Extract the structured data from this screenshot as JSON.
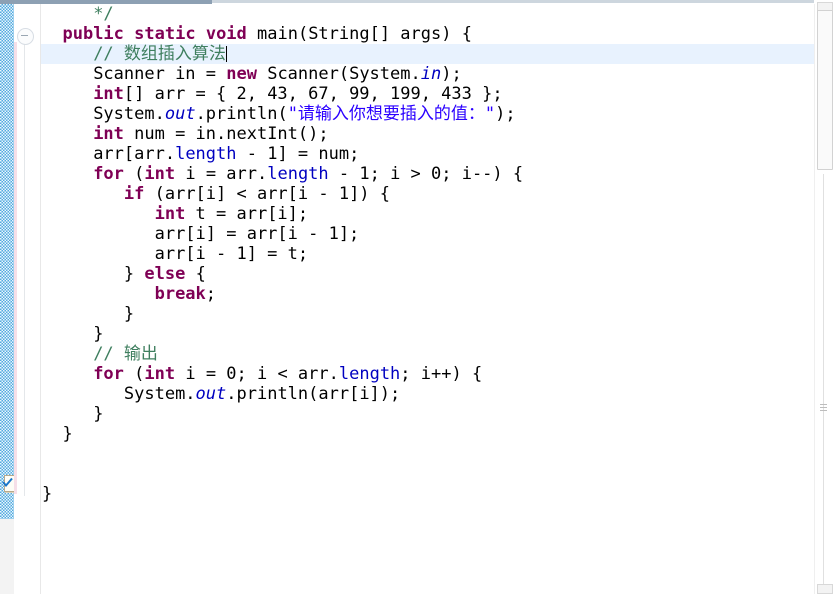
{
  "app": {
    "name": "eclipse-java-editor",
    "language": "java"
  },
  "colors": {
    "keyword": "#7f0055",
    "string": "#2a00ff",
    "comment": "#3f7f5f",
    "field": "#0000c0",
    "plain": "#000000",
    "current_line_highlight": "#e8f2fe",
    "marker_ruler": "#49a6dc",
    "background": "#ffffff"
  },
  "gutter": {
    "fold_marker_icon": "collapse-minus-icon",
    "marker_icon": "quickfix-checkmark-icon"
  },
  "scrollbar": {
    "orientation": "vertical",
    "thumb_top_pct": 1,
    "thumb_height_pct": 27,
    "up_arrow_icon": "scroll-up-arrow-icon",
    "down_arrow_icon": "scroll-down-arrow-icon"
  },
  "editor": {
    "current_line_index": 2,
    "caret_line_index": 2,
    "lines": [
      {
        "indent": 5,
        "tokens": [
          {
            "t": "cmt",
            "s": "*/"
          }
        ]
      },
      {
        "indent": 2,
        "tokens": [
          {
            "t": "kw",
            "s": "public"
          },
          {
            "t": "plain",
            "s": " "
          },
          {
            "t": "kw",
            "s": "static"
          },
          {
            "t": "plain",
            "s": " "
          },
          {
            "t": "kw",
            "s": "void"
          },
          {
            "t": "plain",
            "s": " main(String[] args) {"
          }
        ]
      },
      {
        "indent": 5,
        "current": true,
        "caret": true,
        "tokens": [
          {
            "t": "cmt",
            "s": "// 数组插入算法"
          }
        ]
      },
      {
        "indent": 5,
        "tokens": [
          {
            "t": "plain",
            "s": "Scanner in = "
          },
          {
            "t": "kw",
            "s": "new"
          },
          {
            "t": "plain",
            "s": " Scanner(System."
          },
          {
            "t": "statfld",
            "s": "in"
          },
          {
            "t": "plain",
            "s": ");"
          }
        ]
      },
      {
        "indent": 5,
        "tokens": [
          {
            "t": "kw",
            "s": "int"
          },
          {
            "t": "plain",
            "s": "[] arr = { 2, 43, 67, 99, 199, 433 };"
          }
        ]
      },
      {
        "indent": 5,
        "tokens": [
          {
            "t": "plain",
            "s": "System."
          },
          {
            "t": "statfld",
            "s": "out"
          },
          {
            "t": "plain",
            "s": ".println("
          },
          {
            "t": "str",
            "s": "\"请输入你想要插入的值：\""
          },
          {
            "t": "plain",
            "s": ");"
          }
        ]
      },
      {
        "indent": 5,
        "tokens": [
          {
            "t": "kw",
            "s": "int"
          },
          {
            "t": "plain",
            "s": " num = in.nextInt();"
          }
        ]
      },
      {
        "indent": 5,
        "tokens": [
          {
            "t": "plain",
            "s": "arr[arr."
          },
          {
            "t": "field",
            "s": "length"
          },
          {
            "t": "plain",
            "s": " - 1] = num;"
          }
        ]
      },
      {
        "indent": 5,
        "tokens": [
          {
            "t": "kw",
            "s": "for"
          },
          {
            "t": "plain",
            "s": " ("
          },
          {
            "t": "kw",
            "s": "int"
          },
          {
            "t": "plain",
            "s": " i = arr."
          },
          {
            "t": "field",
            "s": "length"
          },
          {
            "t": "plain",
            "s": " - 1; i > 0; i--) {"
          }
        ]
      },
      {
        "indent": 8,
        "tokens": [
          {
            "t": "kw",
            "s": "if"
          },
          {
            "t": "plain",
            "s": " (arr[i] < arr[i - 1]) {"
          }
        ]
      },
      {
        "indent": 11,
        "tokens": [
          {
            "t": "kw",
            "s": "int"
          },
          {
            "t": "plain",
            "s": " t = arr[i];"
          }
        ]
      },
      {
        "indent": 11,
        "tokens": [
          {
            "t": "plain",
            "s": "arr[i] = arr[i - 1];"
          }
        ]
      },
      {
        "indent": 11,
        "tokens": [
          {
            "t": "plain",
            "s": "arr[i - 1] = t;"
          }
        ]
      },
      {
        "indent": 8,
        "tokens": [
          {
            "t": "plain",
            "s": "} "
          },
          {
            "t": "kw",
            "s": "else"
          },
          {
            "t": "plain",
            "s": " {"
          }
        ]
      },
      {
        "indent": 11,
        "tokens": [
          {
            "t": "kw",
            "s": "break"
          },
          {
            "t": "plain",
            "s": ";"
          }
        ]
      },
      {
        "indent": 8,
        "tokens": [
          {
            "t": "plain",
            "s": "}"
          }
        ]
      },
      {
        "indent": 5,
        "tokens": [
          {
            "t": "plain",
            "s": "}"
          }
        ]
      },
      {
        "indent": 5,
        "tokens": [
          {
            "t": "cmt",
            "s": "// 输出"
          }
        ]
      },
      {
        "indent": 5,
        "tokens": [
          {
            "t": "kw",
            "s": "for"
          },
          {
            "t": "plain",
            "s": " ("
          },
          {
            "t": "kw",
            "s": "int"
          },
          {
            "t": "plain",
            "s": " i = 0; i < arr."
          },
          {
            "t": "field",
            "s": "length"
          },
          {
            "t": "plain",
            "s": "; i++) {"
          }
        ]
      },
      {
        "indent": 8,
        "tokens": [
          {
            "t": "plain",
            "s": "System."
          },
          {
            "t": "statfld",
            "s": "out"
          },
          {
            "t": "plain",
            "s": ".println(arr[i]);"
          }
        ]
      },
      {
        "indent": 5,
        "tokens": [
          {
            "t": "plain",
            "s": "}"
          }
        ]
      },
      {
        "indent": 2,
        "tokens": [
          {
            "t": "plain",
            "s": "}"
          }
        ]
      },
      {
        "indent": 0,
        "tokens": []
      },
      {
        "indent": 0,
        "tokens": []
      },
      {
        "indent": 0,
        "tokens": [
          {
            "t": "plain",
            "s": "}"
          }
        ]
      }
    ]
  }
}
